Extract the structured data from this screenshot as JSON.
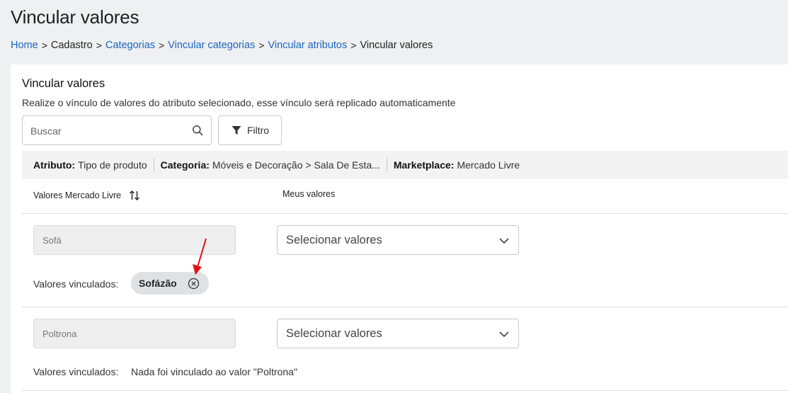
{
  "page": {
    "title": "Vincular valores"
  },
  "breadcrumb": {
    "items": [
      {
        "label": "Home",
        "link": true
      },
      {
        "label": "Cadastro",
        "link": false
      },
      {
        "label": "Categorias",
        "link": true
      },
      {
        "label": "Vincular categorias",
        "link": true
      },
      {
        "label": "Vincular atributos",
        "link": true
      },
      {
        "label": "Vincular valores",
        "link": false
      }
    ],
    "separator": ">"
  },
  "card": {
    "title": "Vincular valores",
    "description": "Realize o vínculo de valores do atributo selecionado, esse vínculo será replicado automaticamente"
  },
  "search": {
    "placeholder": "Buscar",
    "value": "",
    "icon": "search-icon"
  },
  "filter": {
    "label": "Filtro",
    "icon": "filter-icon"
  },
  "info": {
    "attribute_label": "Atributo:",
    "attribute_value": "Tipo de produto",
    "category_label": "Categoria:",
    "category_value": "Móveis e Decoração > Sala De Esta...",
    "marketplace_label": "Marketplace:",
    "marketplace_value": "Mercado Livre"
  },
  "table": {
    "col_marketplace": "Valores Mercado Livre",
    "col_mine": "Meus valores",
    "linked_label": "Valores vinculados:",
    "rows": [
      {
        "marketplace_value": "Sofá",
        "select_placeholder": "Selecionar valores",
        "linked": [
          "Sofázão"
        ],
        "empty_text": ""
      },
      {
        "marketplace_value": "Poltrona",
        "select_placeholder": "Selecionar valores",
        "linked": [],
        "empty_text": "Nada foi vinculado ao valor \"Poltrona\""
      }
    ]
  },
  "colors": {
    "link": "#1a66c2",
    "background": "#eff0f1",
    "chip": "#dfe1e4",
    "annotation_arrow": "#e01010"
  }
}
